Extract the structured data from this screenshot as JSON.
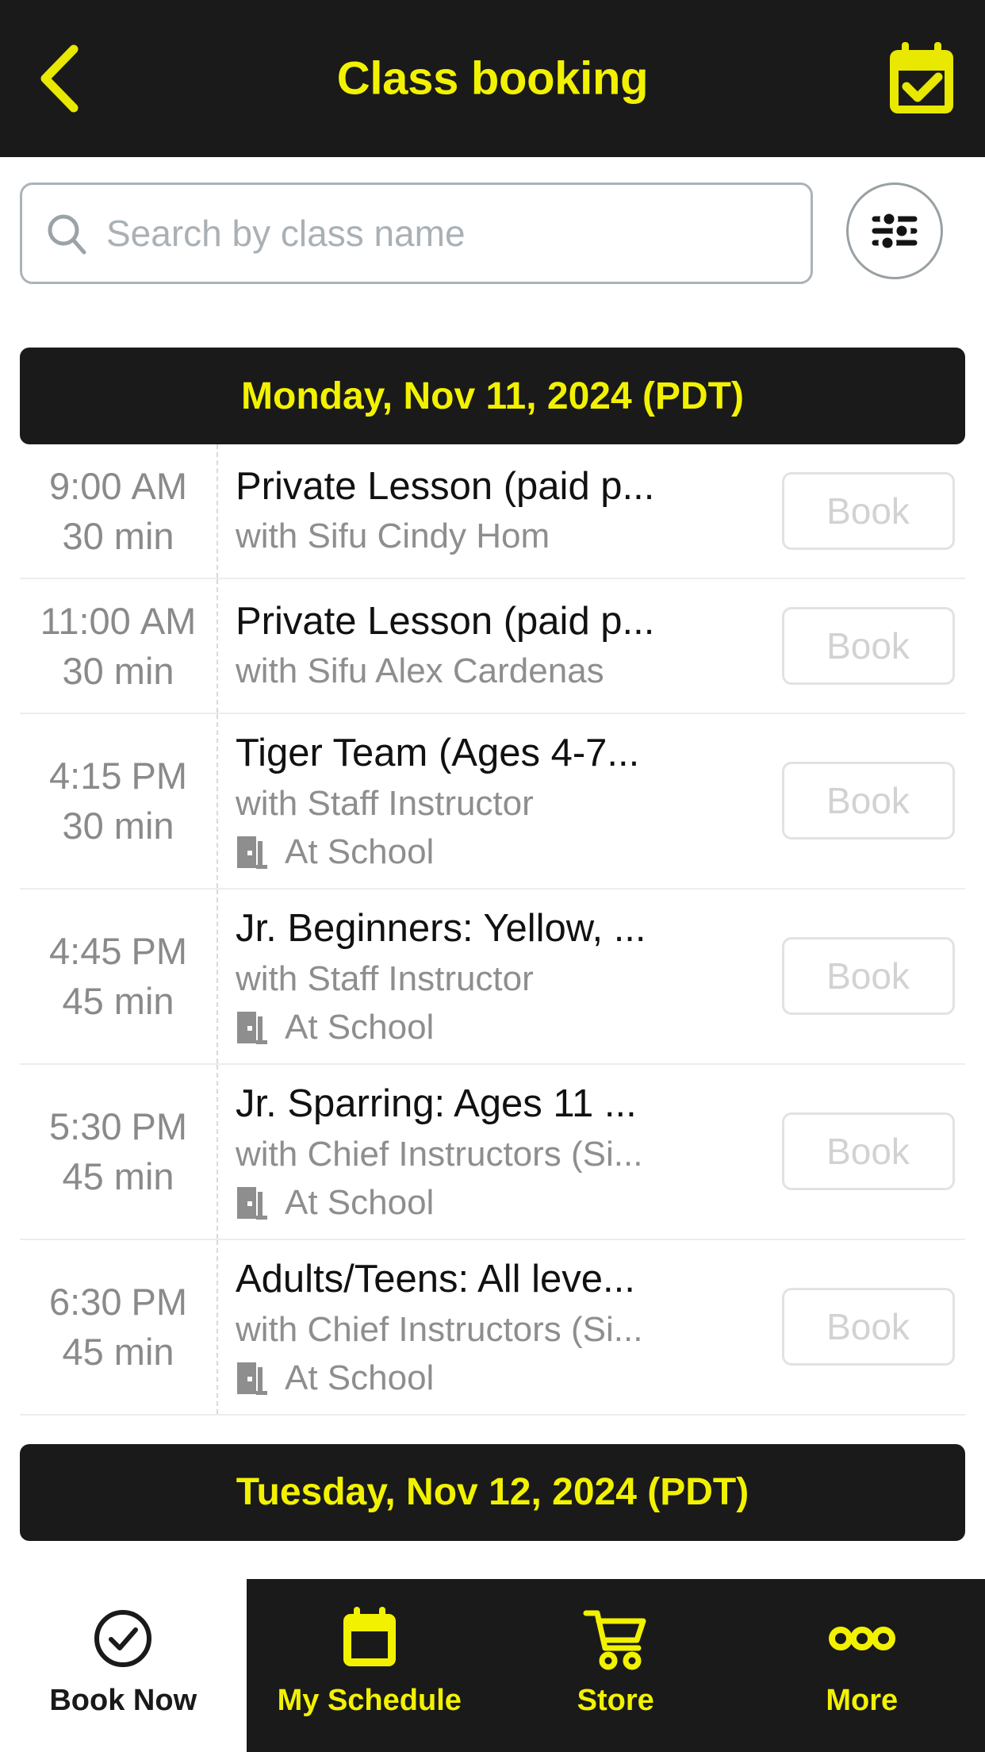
{
  "header": {
    "title": "Class booking",
    "back_icon": "chevron-left-icon",
    "calendar_icon": "calendar-check-icon",
    "accent_color": "#f2f200",
    "background_color": "#1a1a1a"
  },
  "search": {
    "placeholder": "Search by class name",
    "value": "",
    "search_icon": "search-icon",
    "filter_icon": "filter-sliders-icon"
  },
  "schedule": {
    "days": [
      {
        "date_label": "Monday, Nov 11, 2024 (PDT)",
        "classes": [
          {
            "time": "9:00",
            "ampm": "AM",
            "duration": "30 min",
            "title": "Private Lesson (paid p...",
            "instructor": "with Sifu Cindy Hom",
            "location": "",
            "action_label": "Book"
          },
          {
            "time": "11:00",
            "ampm": "AM",
            "duration": "30 min",
            "title": "Private Lesson (paid p...",
            "instructor": "with Sifu Alex Cardenas",
            "location": "",
            "action_label": "Book"
          },
          {
            "time": "4:15",
            "ampm": "PM",
            "duration": "30 min",
            "title": "Tiger Team (Ages 4-7...",
            "instructor": "with Staff Instructor",
            "location": "At School",
            "action_label": "Book"
          },
          {
            "time": "4:45",
            "ampm": "PM",
            "duration": "45 min",
            "title": "Jr. Beginners: Yellow, ...",
            "instructor": "with Staff Instructor",
            "location": "At School",
            "action_label": "Book"
          },
          {
            "time": "5:30",
            "ampm": "PM",
            "duration": "45 min",
            "title": "Jr. Sparring: Ages 11 ...",
            "instructor": "with Chief Instructors (Si...",
            "location": "At School",
            "action_label": "Book"
          },
          {
            "time": "6:30",
            "ampm": "PM",
            "duration": "45 min",
            "title": "Adults/Teens: All leve...",
            "instructor": "with Chief Instructors (Si...",
            "location": "At School",
            "action_label": "Book"
          }
        ]
      },
      {
        "date_label": "Tuesday, Nov 12, 2024 (PDT)",
        "classes": []
      }
    ]
  },
  "bottom_nav": {
    "items": [
      {
        "label": "Book Now",
        "icon": "check-circle-icon",
        "active": false
      },
      {
        "label": "My Schedule",
        "icon": "calendar-icon",
        "active": true
      },
      {
        "label": "Store",
        "icon": "shopping-cart-icon",
        "active": true
      },
      {
        "label": "More",
        "icon": "three-dots-icon",
        "active": true
      }
    ]
  }
}
